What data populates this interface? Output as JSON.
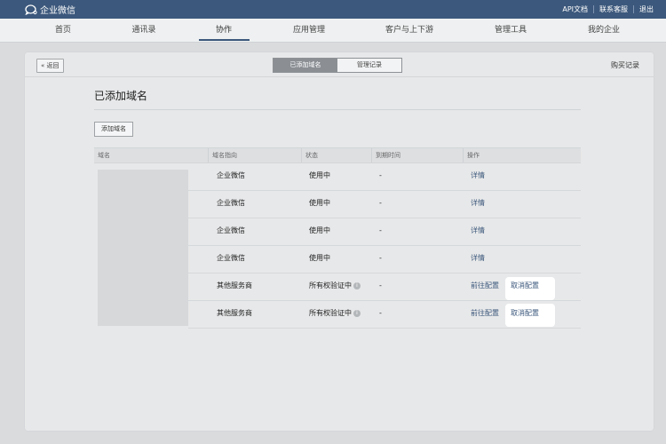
{
  "topbar": {
    "brand": "企业微信",
    "links": [
      "API文档",
      "联系客服",
      "退出"
    ]
  },
  "nav": {
    "items": [
      "首页",
      "通讯录",
      "协作",
      "应用管理",
      "客户与上下游",
      "管理工具",
      "我的企业"
    ],
    "active": "协作"
  },
  "panel": {
    "back_label": "« 返回",
    "segments": [
      "已添加域名",
      "管理记录"
    ],
    "active_segment": "已添加域名",
    "buy_label": "购买记录",
    "title": "已添加域名",
    "add_button": "添加域名"
  },
  "table": {
    "headers": [
      "域名",
      "域名指向",
      "状态",
      "到期时间",
      "操作"
    ],
    "rows": [
      {
        "target": "企业微信",
        "status": "使用中",
        "expire": "-",
        "action1": "详情",
        "action2": ""
      },
      {
        "target": "企业微信",
        "status": "使用中",
        "expire": "-",
        "action1": "详情",
        "action2": ""
      },
      {
        "target": "企业微信",
        "status": "使用中",
        "expire": "-",
        "action1": "详情",
        "action2": ""
      },
      {
        "target": "企业微信",
        "status": "使用中",
        "expire": "-",
        "action1": "详情",
        "action2": ""
      },
      {
        "target": "其他服务商",
        "status": "所有权验证中",
        "expire": "-",
        "action1": "前往配置",
        "action2": "取消配置",
        "status_info": true
      },
      {
        "target": "其他服务商",
        "status": "所有权验证中",
        "expire": "-",
        "action1": "前往配置",
        "action2": "取消配置",
        "status_info": true
      }
    ]
  },
  "colors": {
    "topbar": "#3c587c",
    "link": "#3c587c",
    "background": "#d9dbdd",
    "panel": "#e7e8e9"
  },
  "icons": {
    "logo": "chat-bubble-icon",
    "status_info": "info-icon"
  }
}
